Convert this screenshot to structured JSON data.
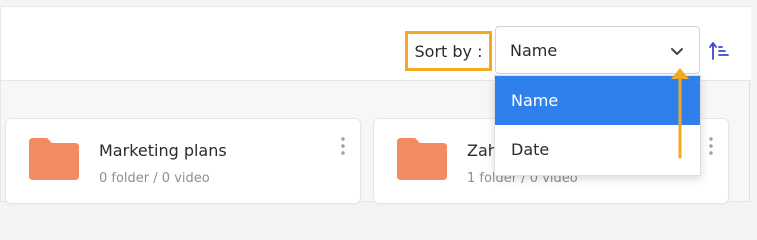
{
  "toolbar": {
    "sort_label": "Sort by :",
    "sort_selected": "Name",
    "sort_direction_icon": "sort-ascending-icon"
  },
  "dropdown": {
    "options": [
      {
        "label": "Name",
        "selected": true
      },
      {
        "label": "Date",
        "selected": false
      }
    ]
  },
  "folders": [
    {
      "name": "Marketing plans",
      "meta": "0 folder / 0 video"
    },
    {
      "name": "Zah",
      "meta": "1 folder / 0 video"
    }
  ],
  "colors": {
    "accent": "#2f80ed",
    "highlight": "#f2a81f",
    "folder": "#f28b62"
  }
}
